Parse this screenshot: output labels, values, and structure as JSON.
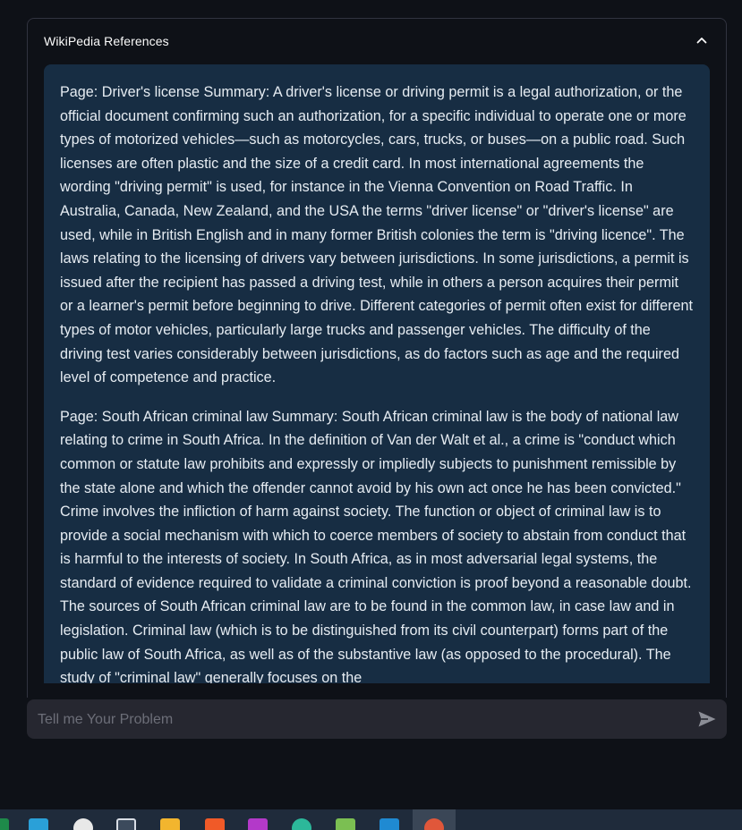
{
  "expander": {
    "title": "WikiPedia References",
    "paragraphs": [
      "Page: Driver's license Summary: A driver's license or driving permit is a legal authorization, or the official document confirming such an authorization, for a specific individual to operate one or more types of motorized vehicles—such as motorcycles, cars, trucks, or buses—on a public road. Such licenses are often plastic and the size of a credit card. In most international agreements the wording \"driving permit\" is used, for instance in the Vienna Convention on Road Traffic. In Australia, Canada, New Zealand, and the USA the terms \"driver license\" or \"driver's license\" are used, while in British English and in many former British colonies the term is \"driving licence\". The laws relating to the licensing of drivers vary between jurisdictions. In some jurisdictions, a permit is issued after the recipient has passed a driving test, while in others a person acquires their permit or a learner's permit before beginning to drive. Different categories of permit often exist for different types of motor vehicles, particularly large trucks and passenger vehicles. The difficulty of the driving test varies considerably between jurisdictions, as do factors such as age and the required level of competence and practice.",
      "Page: South African criminal law Summary: South African criminal law is the body of national law relating to crime in South Africa. In the definition of Van der Walt et al., a crime is \"conduct which common or statute law prohibits and expressly or impliedly subjects to punishment remissible by the state alone and which the offender cannot avoid by his own act once he has been convicted.\" Crime involves the infliction of harm against society. The function or object of criminal law is to provide a social mechanism with which to coerce members of society to abstain from conduct that is harmful to the interests of society. In South Africa, as in most adversarial legal systems, the standard of evidence required to validate a criminal conviction is proof beyond a reasonable doubt. The sources of South African criminal law are to be found in the common law, in case law and in legislation. Criminal law (which is to be distinguished from its civil counterpart) forms part of the public law of South Africa, as well as of the substantive law (as opposed to the procedural). The study of \"criminal law\" generally focuses on the"
    ]
  },
  "chat": {
    "placeholder": "Tell me Your Problem"
  },
  "icons": {
    "collapse": "chevron-up-icon",
    "send": "send-arrow-icon"
  },
  "taskbar": {
    "apps": [
      "spreadsheet-app-icon",
      "notes-app-icon",
      "chrome-icon",
      "virtualbox-icon",
      "file-explorer-icon",
      "brave-icon",
      "intellij-icon",
      "edge-icon",
      "paint-icon",
      "vscode-icon",
      "active-app-icon"
    ]
  },
  "colors": {
    "background": "#0e1117",
    "reference_box": "#172d43",
    "chat_bar": "#262730",
    "border": "#31333f"
  }
}
